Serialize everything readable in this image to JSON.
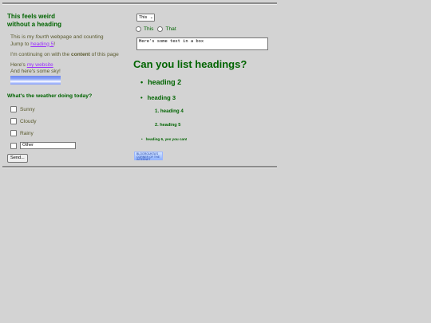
{
  "left": {
    "title_line1": "This feels weird",
    "title_line2": "without a heading",
    "intro_prefix": "This is my ",
    "intro_emph": "fourth",
    "intro_suffix": " webpage and counting",
    "jump_prefix": "Jump to ",
    "jump_link": "heading 5",
    "jump_suffix": "!",
    "para_prefix": "I'm continuing on with the ",
    "para_bold": "content",
    "para_suffix": " of this page",
    "here_prefix": "Here's ",
    "here_link": "my website",
    "sky_text": "And here's some sky!",
    "weather_heading": "What's the weather doing today?",
    "options": [
      "Sunny",
      "Cloudy",
      "Rainy"
    ],
    "other_value": "Other",
    "send_label": "Send..."
  },
  "right": {
    "select_value": "This",
    "radio1": "This",
    "radio2": "That",
    "textbox_value": "Here's some text in a box",
    "h1": "Can you list headings?",
    "h2": "heading 2",
    "h3": "heading 3",
    "h4_num": "1.",
    "h4": "heading 4",
    "h5_num": "2.",
    "h5": "heading 5",
    "h6": "heading 6, yes you can!",
    "badge_text": "BLOGROUNTA'S CORNER OF THE INTERNET"
  }
}
